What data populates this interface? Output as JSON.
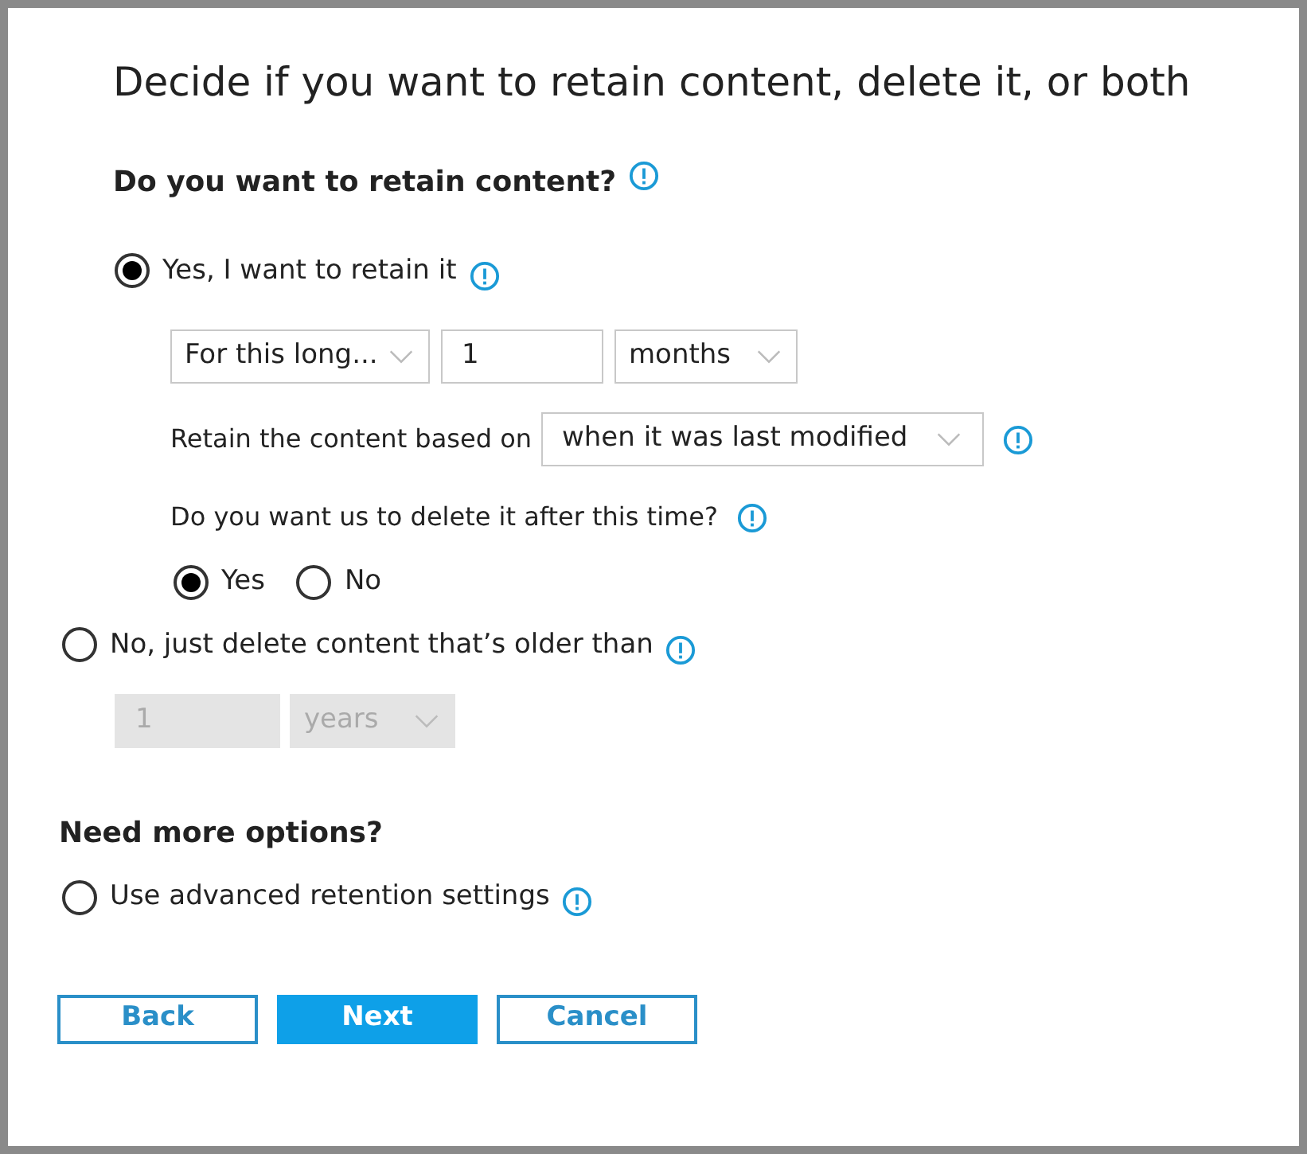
{
  "title": "Decide if you want to retain content, delete it, or both",
  "retain_heading": "Do you want to retain content?",
  "retain_option": {
    "label": "Yes, I want to retain it",
    "selected": true
  },
  "retain_fields": [
    {
      "kind": "dropdown",
      "value": "For this long...",
      "disabled": false
    },
    {
      "kind": "input",
      "value": "1",
      "disabled": false
    },
    {
      "kind": "dropdown",
      "value": "months",
      "disabled": false
    }
  ],
  "based_on": {
    "label": "Retain the content based on",
    "value": "when it was last modified"
  },
  "delete_question": "Do you want us to delete it after this time?",
  "delete_choices": [
    {
      "label": "Yes",
      "selected": true
    },
    {
      "label": "No",
      "selected": false
    }
  ],
  "delete_option": {
    "label": "No, just delete content that’s older than",
    "selected": false
  },
  "delete_fields": [
    {
      "kind": "input",
      "value": "1",
      "disabled": true
    },
    {
      "kind": "dropdown",
      "value": "years",
      "disabled": true
    }
  ],
  "more_heading": "Need more options?",
  "advanced_option": {
    "label": "Use advanced retention settings",
    "selected": false
  },
  "buttons": [
    {
      "label": "Back",
      "primary": false
    },
    {
      "label": "Next",
      "primary": true
    },
    {
      "label": "Cancel",
      "primary": false
    }
  ]
}
